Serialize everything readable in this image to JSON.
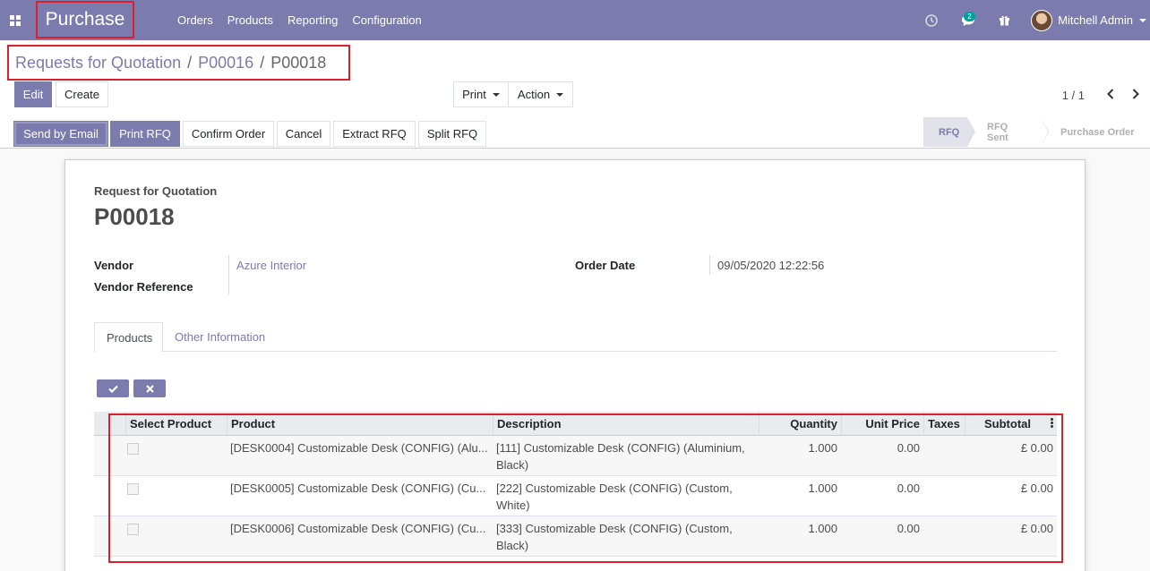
{
  "app": {
    "brand": "Purchase"
  },
  "menu": [
    "Orders",
    "Products",
    "Reporting",
    "Configuration"
  ],
  "systray": {
    "message_count": "2",
    "user_name": "Mitchell Admin"
  },
  "breadcrumb": {
    "items": [
      "Requests for Quotation",
      "P00016"
    ],
    "current": "P00018"
  },
  "buttons": {
    "edit": "Edit",
    "create": "Create",
    "print": "Print",
    "action": "Action"
  },
  "pager": {
    "value": "1 / 1"
  },
  "header_buttons": [
    "Send by Email",
    "Print RFQ",
    "Confirm Order",
    "Cancel",
    "Extract RFQ",
    "Split RFQ"
  ],
  "stages": [
    {
      "label": "RFQ",
      "active": true
    },
    {
      "label": "RFQ Sent",
      "active": false
    },
    {
      "label": "Purchase Order",
      "active": false
    }
  ],
  "form": {
    "doc_type": "Request for Quotation",
    "name": "P00018",
    "vendor_label": "Vendor",
    "vendor_value": "Azure Interior",
    "vendor_ref_label": "Vendor Reference",
    "vendor_ref_value": "",
    "order_date_label": "Order Date",
    "order_date_value": "09/05/2020 12:22:56"
  },
  "tabs": [
    "Products",
    "Other Information"
  ],
  "table": {
    "columns": [
      "Select Product",
      "Product",
      "Description",
      "Quantity",
      "Unit Price",
      "Taxes",
      "Subtotal"
    ],
    "rows": [
      {
        "product": "[DESK0004] Customizable Desk (CONFIG) (Alu...",
        "description": "[111] Customizable Desk (CONFIG) (Aluminium, Black)",
        "quantity": "1.000",
        "unit_price": "0.00",
        "taxes": "",
        "subtotal": "£ 0.00"
      },
      {
        "product": "[DESK0005] Customizable Desk (CONFIG) (Cu...",
        "description": "[222] Customizable Desk (CONFIG) (Custom, White)",
        "quantity": "1.000",
        "unit_price": "0.00",
        "taxes": "",
        "subtotal": "£ 0.00"
      },
      {
        "product": "[DESK0006] Customizable Desk (CONFIG) (Cu...",
        "description": "[333] Customizable Desk (CONFIG) (Custom, Black)",
        "quantity": "1.000",
        "unit_price": "0.00",
        "taxes": "",
        "subtotal": "£ 0.00"
      }
    ]
  },
  "colors": {
    "primary": "#7c7bad",
    "highlight": "#d9202c"
  }
}
